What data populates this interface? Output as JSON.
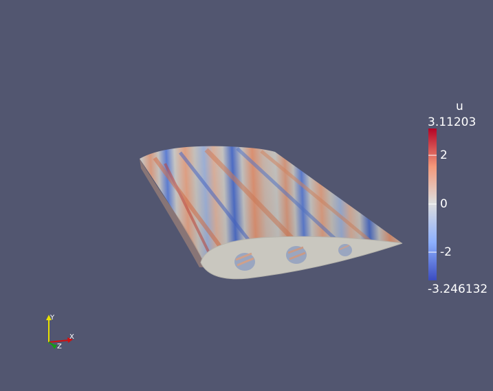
{
  "colorbar": {
    "title": "u",
    "max_label": "3.11203",
    "min_label": "-3.246132",
    "range": [
      -3.246132,
      3.11203
    ],
    "ticks": [
      {
        "value": 2,
        "label": "2"
      },
      {
        "value": 0,
        "label": "0"
      },
      {
        "value": -2,
        "label": "-2"
      }
    ],
    "colormap": [
      "#3b4cc0",
      "#8db0fe",
      "#dddddd",
      "#f4987a",
      "#b40426"
    ]
  },
  "axes": {
    "x_label": "X",
    "y_label": "Y",
    "z_label": "Z",
    "x_color": "#d01010",
    "y_color": "#e8e000",
    "z_color": "#10a010"
  },
  "colors": {
    "background": "#525670",
    "section_face": "#c9c7bf"
  }
}
